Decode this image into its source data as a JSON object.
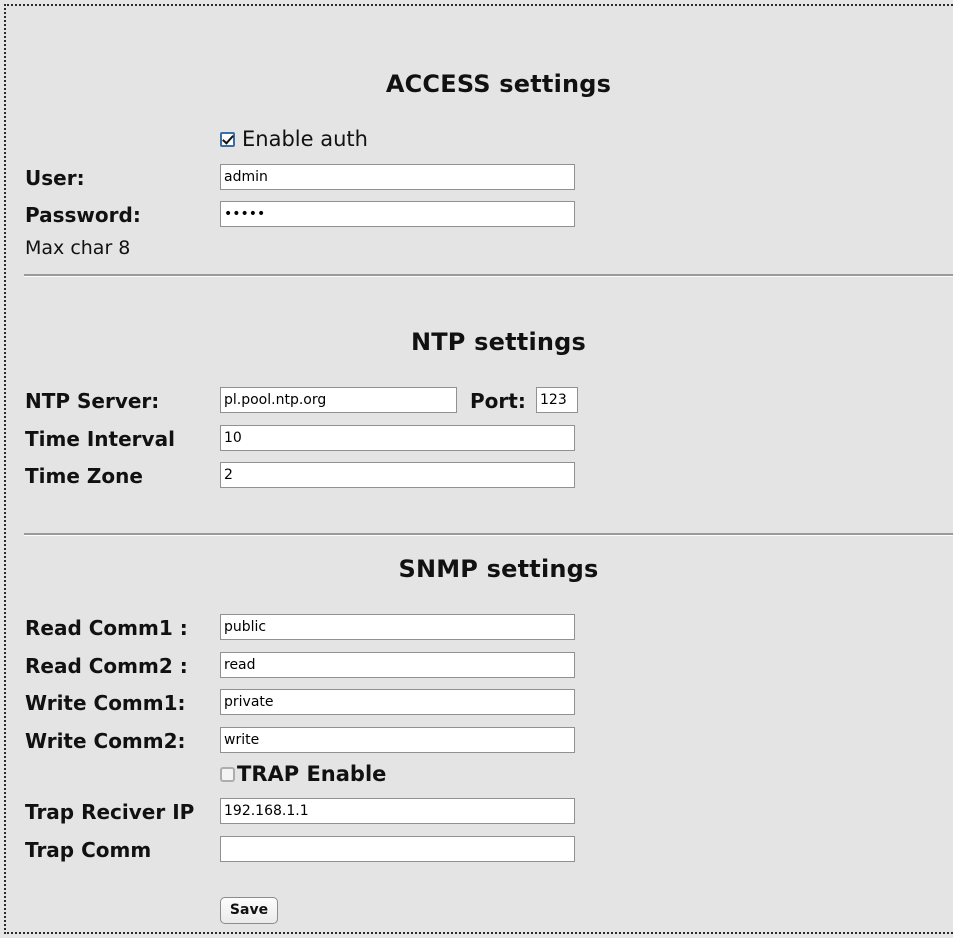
{
  "sections": {
    "access": {
      "title": "ACCESS settings",
      "enable_auth": {
        "label": "Enable auth",
        "checked": true
      },
      "user": {
        "label": "User:",
        "value": "admin"
      },
      "password": {
        "label": "Password:",
        "value": "•••••"
      },
      "note": "Max char 8"
    },
    "ntp": {
      "title": "NTP settings",
      "server": {
        "label": "NTP Server:",
        "value": "pl.pool.ntp.org"
      },
      "port": {
        "label": "Port:",
        "value": "123"
      },
      "time_interval": {
        "label": "Time Interval",
        "value": "10"
      },
      "time_zone": {
        "label": "Time Zone",
        "value": "2"
      }
    },
    "snmp": {
      "title": "SNMP settings",
      "read_comm1": {
        "label": "Read Comm1 :",
        "value": "public"
      },
      "read_comm2": {
        "label": "Read Comm2 :",
        "value": "read"
      },
      "write_comm1": {
        "label": "Write Comm1:",
        "value": "private"
      },
      "write_comm2": {
        "label": "Write Comm2:",
        "value": "write"
      },
      "trap_enable": {
        "label": "TRAP Enable",
        "checked": false
      },
      "trap_receiver_ip": {
        "label": "Trap Reciver IP",
        "value": "192.168.1.1"
      },
      "trap_comm": {
        "label": "Trap Comm",
        "value": ""
      }
    }
  },
  "actions": {
    "save_label": "Save"
  },
  "colors": {
    "background": "#e4e4e4",
    "input_background": "#ffffff",
    "input_border": "#919191",
    "text": "#111111",
    "checkbox_checked_border": "#3a6ea5",
    "checkbox_unchecked_border": "#adadad",
    "divider": "#9a9a9a"
  }
}
